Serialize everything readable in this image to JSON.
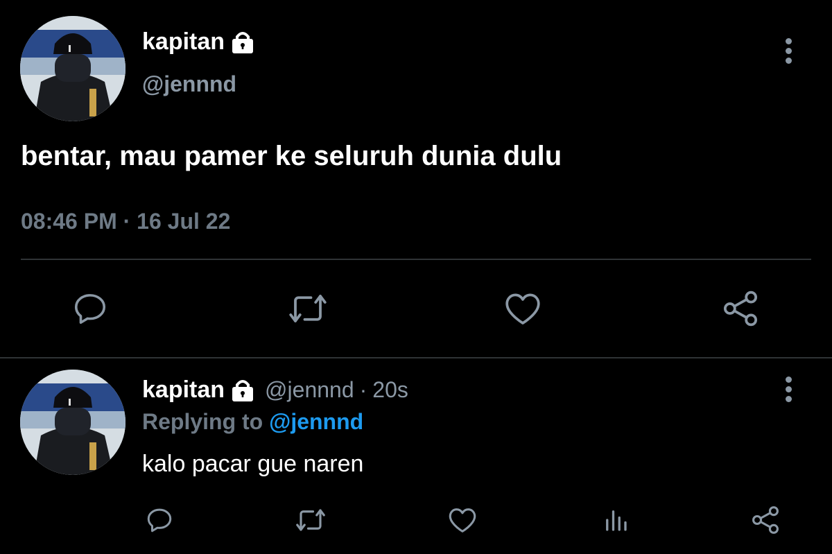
{
  "main_tweet": {
    "author_name": "kapitan",
    "author_handle": "@jennnd",
    "text": "bentar, mau pamer ke seluruh dunia dulu",
    "timestamp": "08:46 PM · 16 Jul 22",
    "locked": true,
    "actions": [
      "reply-icon",
      "retweet-icon",
      "like-icon",
      "share-icon"
    ]
  },
  "reply_tweet": {
    "author_name": "kapitan",
    "author_handle": "@jennnd",
    "separator": "·",
    "time_ago": "20s",
    "replying_label": "Replying to",
    "replying_to": "@jennnd",
    "text": "kalo pacar gue naren",
    "locked": true,
    "actions": [
      "reply-icon",
      "retweet-icon",
      "like-icon",
      "analytics-icon",
      "share-icon"
    ]
  },
  "colors": {
    "background": "#000000",
    "text_primary": "#ffffff",
    "text_secondary": "#8b98a5",
    "accent": "#1d9bf0",
    "divider": "#2f3336"
  }
}
